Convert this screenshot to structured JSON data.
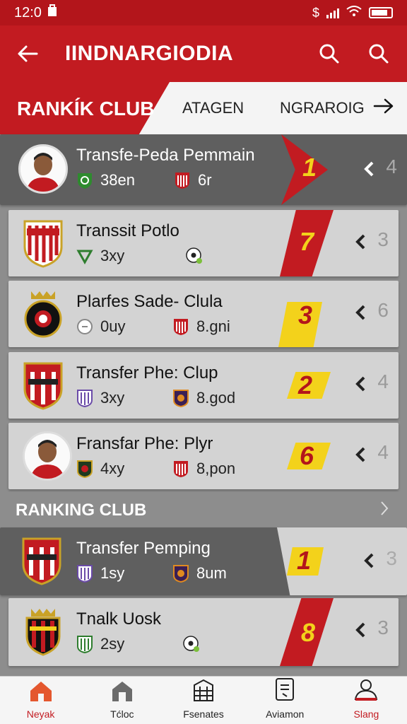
{
  "status_bar": {
    "time": "12:0",
    "carrier_symbol": "$"
  },
  "app_bar": {
    "title": "IINDNARGIODIA",
    "back_icon": "back-arrow-icon",
    "actions": [
      "search-icon",
      "search-icon"
    ]
  },
  "tabs": {
    "active_label": "RANKÍK CLUB",
    "items": [
      "ATAGEN",
      "NGRAROIG"
    ],
    "arrow_icon": "arrow-right-icon"
  },
  "rows": [
    {
      "name": "Transfe-Peda Pemmain",
      "stat1": "38en",
      "stat2": "6r",
      "rank": "1",
      "pos": "4",
      "badge": "avatar",
      "rank_style": "red"
    },
    {
      "name": "Transsit Potlo",
      "stat1": "3xy",
      "stat2": "",
      "rank": "7",
      "pos": "3",
      "badge": "crest",
      "rank_style": "red"
    },
    {
      "name": "Plarfes Sade- Clula",
      "stat1": "0uy",
      "stat2": "8.gni",
      "rank": "3",
      "pos": "6",
      "badge": "crest",
      "rank_style": "yellow"
    },
    {
      "name": "Transfer Phe: Clup",
      "stat1": "3xy",
      "stat2": "8.god",
      "rank": "2",
      "pos": "4",
      "badge": "crest",
      "rank_style": "yellow"
    },
    {
      "name": "Fransfar Phe: Plyr",
      "stat1": "4xy",
      "stat2": "8,pon",
      "rank": "6",
      "pos": "4",
      "badge": "avatar",
      "rank_style": "yellow"
    }
  ],
  "section": {
    "label": "RANKING CLUB"
  },
  "rows2": [
    {
      "name": "Transfer Pemping",
      "stat1": "1sy",
      "stat2": "8um",
      "rank": "1",
      "pos": "3",
      "badge": "crest",
      "rank_style": "yellow"
    },
    {
      "name": "Tnalk Uosk",
      "stat1": "2sy",
      "stat2": "",
      "rank": "8",
      "pos": "3",
      "badge": "crest",
      "rank_style": "red"
    }
  ],
  "bottom_nav": [
    {
      "label": "Neyak",
      "icon": "home-icon"
    },
    {
      "label": "Tćloc",
      "icon": "house-outline-icon"
    },
    {
      "label": "Fsenates",
      "icon": "building-icon"
    },
    {
      "label": "Aviamon",
      "icon": "document-icon"
    },
    {
      "label": "Slang",
      "icon": "profile-icon"
    }
  ],
  "colors": {
    "brand_red": "#c21b21",
    "rank_yellow": "#f3d21b",
    "row_bg": "#d3d3d3",
    "row_dark_bg": "#5f5f5f"
  }
}
